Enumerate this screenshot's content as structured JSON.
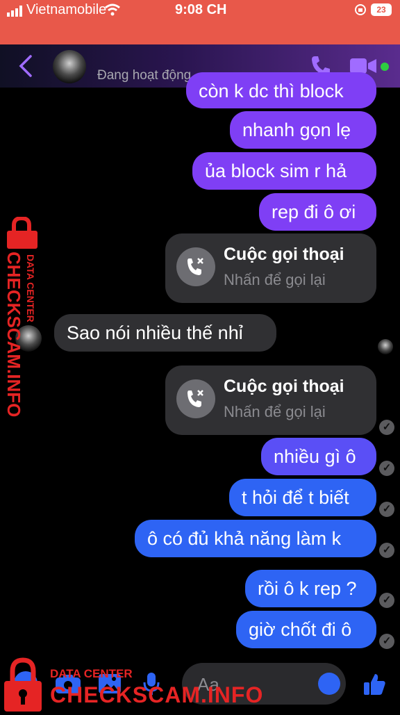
{
  "status_bar": {
    "carrier": "Vietnamobile",
    "time": "9:08 CH",
    "battery": "23"
  },
  "header": {
    "presence": "Đang hoạt động",
    "accent_color": "#a06cff",
    "online_color": "#2ecc40"
  },
  "messages": [
    {
      "kind": "out",
      "text": "còn k dc thì block"
    },
    {
      "kind": "out",
      "text": "nhanh gọn lẹ"
    },
    {
      "kind": "out",
      "text": "ủa block sim r hả"
    },
    {
      "kind": "out",
      "text": "rep đi ô ơi"
    },
    {
      "kind": "call",
      "title": "Cuộc gọi thoại",
      "subtitle": "Nhấn để gọi lại"
    },
    {
      "kind": "in",
      "text": "Sao nói nhiều thế nhỉ"
    },
    {
      "kind": "call",
      "title": "Cuộc gọi thoại",
      "subtitle": "Nhấn để gọi lại"
    },
    {
      "kind": "out",
      "text": "nhiều gì ô"
    },
    {
      "kind": "out",
      "text": "t hỏi để t biết"
    },
    {
      "kind": "out",
      "text": "ô có đủ khả năng làm k"
    },
    {
      "kind": "out",
      "text": "rồi ô k rep ?"
    },
    {
      "kind": "out",
      "text": "giờ chốt đi ô"
    }
  ],
  "composer": {
    "placeholder": "Aa"
  },
  "watermark": {
    "side_top": "DATA CENTER",
    "side_main": "CHECKSCAM.INFO",
    "bottom_top": "DATA CENTER",
    "bottom_main": "CHECKSCAM.INFO"
  },
  "colors": {
    "status_bar": "#e8584a",
    "bubble_purple": "#7f3ff5",
    "bubble_blue": "#2e64f4",
    "bubble_gray": "#303033",
    "watermark": "#e52424"
  }
}
